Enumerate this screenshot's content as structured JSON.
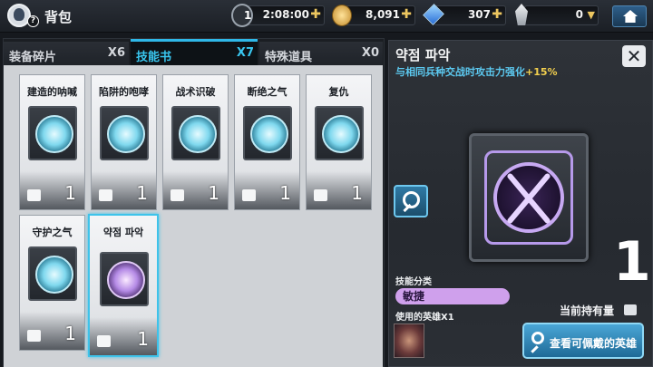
{
  "header": {
    "title": "背包",
    "help_mark": "?",
    "timer_badge": "1",
    "timer": "2:08:00",
    "gold": "8,091",
    "gems": "307",
    "crystals": "0",
    "plus": "✚",
    "dropdown": "▼"
  },
  "tabs": [
    {
      "label": "装备碎片",
      "count": "X6",
      "active": false
    },
    {
      "label": "技能书",
      "count": "X7",
      "active": true
    },
    {
      "label": "特殊道具",
      "count": "X0",
      "active": false
    }
  ],
  "skillbooks": [
    {
      "name": "建造的呐喊",
      "count": "1"
    },
    {
      "name": "陷阱的咆哮",
      "count": "1"
    },
    {
      "name": "战术识破",
      "count": "1"
    },
    {
      "name": "断绝之气",
      "count": "1"
    },
    {
      "name": "复仇",
      "count": "1"
    },
    {
      "name": "守护之气",
      "count": "1"
    },
    {
      "name": "약점 파악",
      "count": "1",
      "selected": true
    }
  ],
  "detail": {
    "name": "약점 파악",
    "desc_main": "与相同兵种交战时攻击力强化",
    "desc_pct": "+15%",
    "close": "✕",
    "category_label": "技能分类",
    "category_value": "敏捷",
    "owned_label": "当前持有量",
    "owned_count": "1",
    "used_heroes_label": "使用的英雄X1",
    "view_button": "查看可佩戴的英雄"
  },
  "colors": {
    "accent_blue": "#39c6ef",
    "gold_plus": "#ecc660",
    "category_pill": "#cfa0ec",
    "percent": "#f3d04e"
  }
}
